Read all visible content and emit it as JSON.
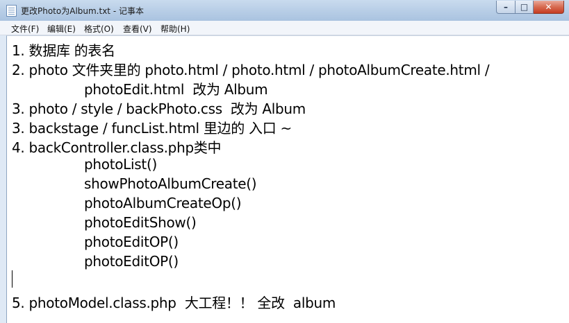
{
  "window": {
    "title": "更改Photo为Album.txt - 记事本",
    "min_glyph": "–",
    "max_glyph": "□",
    "close_glyph": "✕",
    "close_color": "#c43b21"
  },
  "menu": {
    "file": "文件(F)",
    "edit": "编辑(E)",
    "format": "格式(O)",
    "view": "查看(V)",
    "help": "帮助(H)"
  },
  "document": {
    "lines": [
      "1. 数据库 的表名",
      "2. photo 文件夹里的 photo.html / photo.html / photoAlbumCreate.html /",
      "photoEdit.html  改为 Album",
      "3. photo / style / backPhoto.css  改为 Album",
      "3. backstage / funcList.html 里边的 入口 ~",
      "4. backController.class.php类中",
      "photoList()",
      "showPhotoAlbumCreate()",
      "photoAlbumCreateOp()",
      "photoEditShow()",
      "photoEditOP()",
      "photoEditOP()",
      "",
      "5. photoModel.class.php  大工程！！ 全改  album"
    ]
  }
}
